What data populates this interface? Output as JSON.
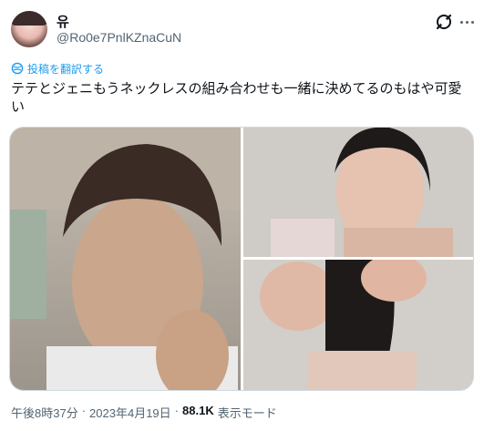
{
  "author": {
    "name": "유",
    "handle": "@Ro0e7PnlKZnaCuN"
  },
  "translate_label": "投稿を翻訳する",
  "tweet_text": "テテとジェニもうネックレスの組み合わせも一緒に決めてるのもはや可愛い",
  "icons": {
    "grok": "grok-icon",
    "more": "more-icon",
    "translate": "globe-icon"
  },
  "accent_color": "#1d9bf0",
  "meta": {
    "time": "午後8時37分",
    "sep1": "·",
    "date": "2023年4月19日",
    "sep2": "·",
    "views": "88.1K",
    "views_label": "表示モード"
  }
}
